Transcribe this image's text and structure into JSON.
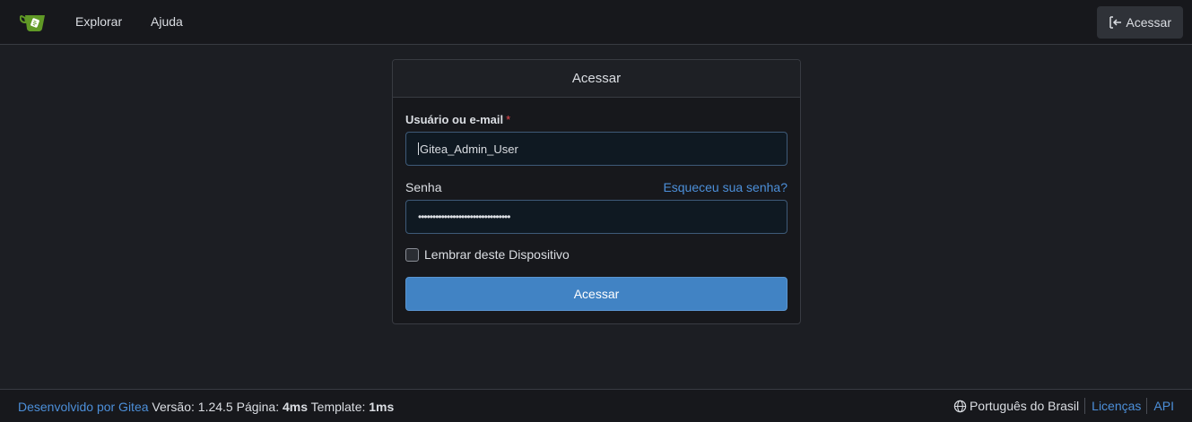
{
  "navbar": {
    "logo_icon": "gitea-teacup-icon",
    "explore_label": "Explorar",
    "help_label": "Ajuda",
    "signin_label": "Acessar",
    "signin_icon": "sign-in-icon"
  },
  "login": {
    "title": "Acessar",
    "username_label": "Usuário ou e-mail",
    "required_mark": "*",
    "username_value": "Gitea_Admin_User",
    "password_label": "Senha",
    "forgot_label": "Esqueceu sua senha?",
    "password_masked": "••••••••••••••••••••••••••••••••",
    "remember_label": "Lembrar deste Dispositivo",
    "remember_checked": false,
    "submit_label": "Acessar"
  },
  "footer": {
    "powered_by": "Desenvolvido por Gitea",
    "version_label": "Versão:",
    "version": "1.24.5",
    "page_label": "Página:",
    "page_time": "4ms",
    "template_label": "Template:",
    "template_time": "1ms",
    "language": "Português do Brasil",
    "language_icon": "globe-icon",
    "licenses": "Licenças",
    "api": "API"
  },
  "colors": {
    "background": "#1c1e23",
    "navbar": "#17181c",
    "primary_button": "#4183c4",
    "link": "#4c8fd9",
    "required": "#e5484d"
  }
}
